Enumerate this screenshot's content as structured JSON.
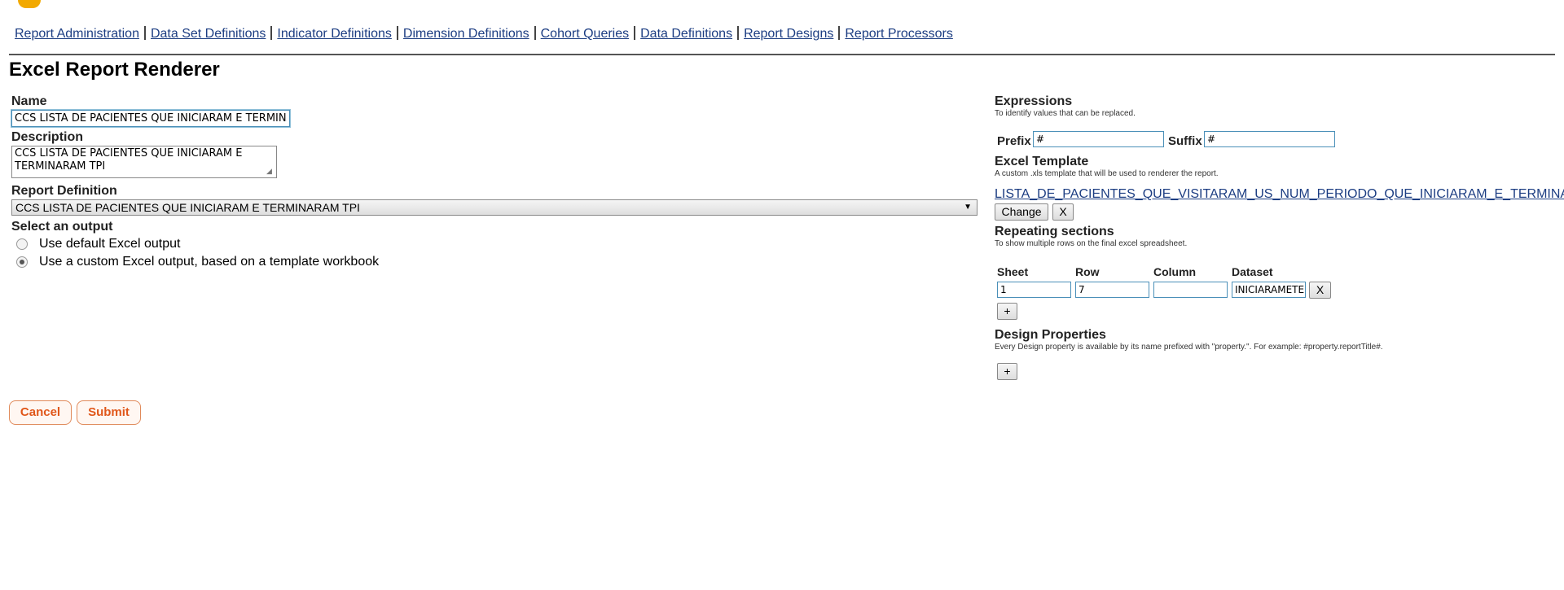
{
  "nav": {
    "items": [
      {
        "label": "Report Administration"
      },
      {
        "label": "Data Set Definitions"
      },
      {
        "label": "Indicator Definitions"
      },
      {
        "label": "Dimension Definitions"
      },
      {
        "label": "Cohort Queries"
      },
      {
        "label": "Data Definitions"
      },
      {
        "label": "Report Designs"
      },
      {
        "label": "Report Processors"
      }
    ]
  },
  "page": {
    "title": "Excel Report Renderer"
  },
  "form": {
    "name_label": "Name",
    "name_value": "CCS LISTA DE PACIENTES QUE INICIARAM E TERMINARAM TPI",
    "description_label": "Description",
    "description_value": "CCS LISTA DE PACIENTES QUE INICIARAM E TERMINARAM TPI",
    "report_definition_label": "Report Definition",
    "report_definition_selected": "CCS LISTA DE PACIENTES QUE INICIARAM E TERMINARAM TPI",
    "output_label": "Select an output",
    "output_options": [
      {
        "label": "Use default Excel output",
        "checked": false
      },
      {
        "label": "Use a custom Excel output, based on a template workbook",
        "checked": true
      }
    ]
  },
  "expressions": {
    "title": "Expressions",
    "subtitle": "To identify values that can be replaced.",
    "prefix_label": "Prefix",
    "prefix_value": "#",
    "suffix_label": "Suffix",
    "suffix_value": "#"
  },
  "template": {
    "title": "Excel Template",
    "subtitle": "A custom .xls template that will be used to renderer the report.",
    "file_name": "LISTA_DE_PACIENTES_QUE_VISITARAM_US_NUM_PERIODO_QUE_INICIARAM_E_TERMINARAM_TPI",
    "change_label": "Change",
    "remove_label": "X"
  },
  "repeating": {
    "title": "Repeating sections",
    "subtitle": "To show multiple rows on the final excel spreadsheet.",
    "columns": [
      "Sheet",
      "Row",
      "Column",
      "Dataset"
    ],
    "rows": [
      {
        "sheet": "1",
        "row": "7",
        "column": "",
        "dataset": "INICIARAMETERMINARAMTPI"
      }
    ],
    "remove_label": "X",
    "add_label": "+"
  },
  "design_properties": {
    "title": "Design Properties",
    "subtitle": "Every Design property is available by its name prefixed with \"property.\". For example: #property.reportTitle#.",
    "add_label": "+"
  },
  "actions": {
    "cancel_label": "Cancel",
    "submit_label": "Submit"
  },
  "colors": {
    "link": "#1c3d82",
    "action_text": "#e0571a",
    "action_border": "#e08a5a",
    "logo": "#f2a900"
  },
  "icons": {
    "dropdown": "chevron-down-icon",
    "resize_grip": "resize-grip-icon"
  }
}
